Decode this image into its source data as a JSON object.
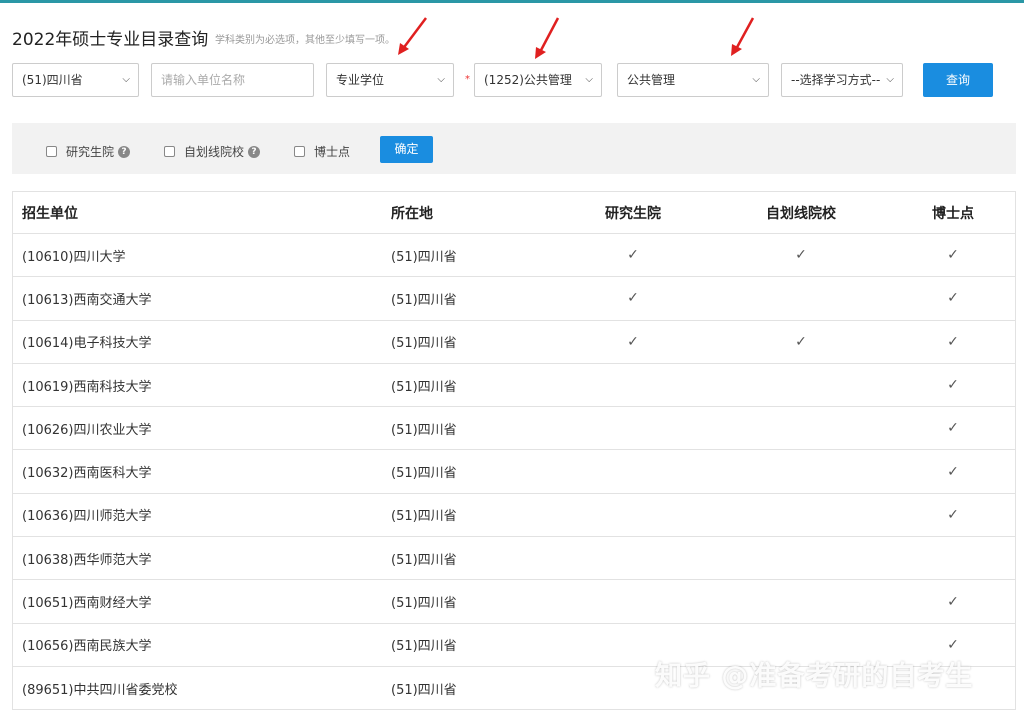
{
  "page": {
    "title": "2022年硕士专业目录查询",
    "hint": "学科类别为必选项，其他至少填写一项。"
  },
  "search": {
    "province": "(51)四川省",
    "unit_placeholder": "请输入单位名称",
    "degree_type": "专业学位",
    "discipline": "(1252)公共管理",
    "major": "公共管理",
    "study_mode": "--选择学习方式--",
    "query_label": "查询"
  },
  "filters": {
    "graduate_school": "研究生院",
    "self_line": "自划线院校",
    "doctoral": "博士点",
    "confirm_label": "确定"
  },
  "table": {
    "headers": [
      "招生单位",
      "所在地",
      "研究生院",
      "自划线院校",
      "博士点"
    ],
    "rows": [
      {
        "name": "(10610)四川大学",
        "loc": "(51)四川省",
        "grad": "✓",
        "self": "✓",
        "doc": "✓"
      },
      {
        "name": "(10613)西南交通大学",
        "loc": "(51)四川省",
        "grad": "✓",
        "self": "",
        "doc": "✓"
      },
      {
        "name": "(10614)电子科技大学",
        "loc": "(51)四川省",
        "grad": "✓",
        "self": "✓",
        "doc": "✓"
      },
      {
        "name": "(10619)西南科技大学",
        "loc": "(51)四川省",
        "grad": "",
        "self": "",
        "doc": "✓"
      },
      {
        "name": "(10626)四川农业大学",
        "loc": "(51)四川省",
        "grad": "",
        "self": "",
        "doc": "✓"
      },
      {
        "name": "(10632)西南医科大学",
        "loc": "(51)四川省",
        "grad": "",
        "self": "",
        "doc": "✓"
      },
      {
        "name": "(10636)四川师范大学",
        "loc": "(51)四川省",
        "grad": "",
        "self": "",
        "doc": "✓"
      },
      {
        "name": "(10638)西华师范大学",
        "loc": "(51)四川省",
        "grad": "",
        "self": "",
        "doc": ""
      },
      {
        "name": "(10651)西南财经大学",
        "loc": "(51)四川省",
        "grad": "",
        "self": "",
        "doc": "✓"
      },
      {
        "name": "(10656)西南民族大学",
        "loc": "(51)四川省",
        "grad": "",
        "self": "",
        "doc": "✓"
      },
      {
        "name": "(89651)中共四川省委党校",
        "loc": "(51)四川省",
        "grad": "",
        "self": "",
        "doc": ""
      }
    ]
  },
  "watermark": "知乎 @准备考研的自考生",
  "colors": {
    "accent": "#1a8de0",
    "arrow": "#e02020",
    "top_bar": "#2a97a6"
  },
  "icons": {
    "dropdown": "chevron-down-icon",
    "help": "question-circle-icon",
    "check": "check-icon"
  }
}
